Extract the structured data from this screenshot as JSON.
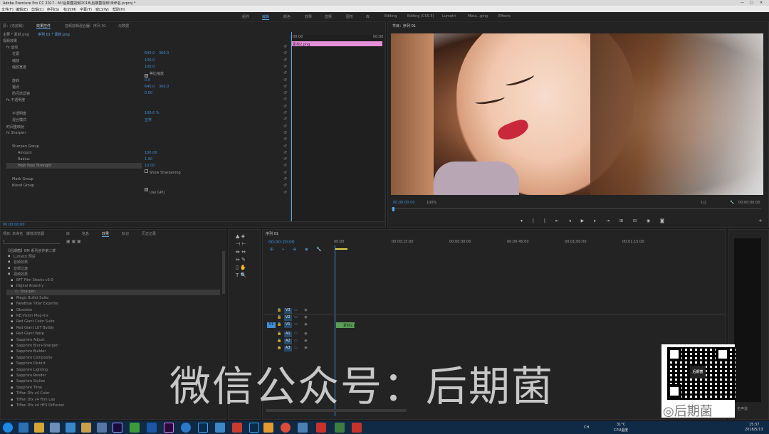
{
  "titlebar": {
    "title": "Adobe Premiere Pro CC 2017 - M:\\后期菌视频2018\\后期菌视频\\未命名.prproj *",
    "controls": [
      "—",
      "□",
      "✕"
    ]
  },
  "menubar": [
    "文件(F)",
    "编辑(E)",
    "剪辑(C)",
    "序列(S)",
    "标记(M)",
    "字幕(T)",
    "窗口(W)",
    "帮助(H)"
  ],
  "workspaces": {
    "items": [
      "组件",
      "编辑",
      "颜色",
      "效果",
      "音频",
      "图形",
      "库",
      "Editing",
      "Editing (CS5.5)",
      "Lumetri",
      "Meta...ging",
      "Effects"
    ],
    "active_index": 1
  },
  "effect_controls": {
    "tabs": [
      "源：(无剪辑)",
      "效果控件",
      "音频剪辑混合器：序列 01",
      "元数据"
    ],
    "active_tab": 1,
    "breadcrumb_source": "主要 * 素材.png",
    "breadcrumb_seq": "序列 01 * 素材.png",
    "section": "视频效果",
    "rows": [
      {
        "label": "fx 运动",
        "value": "",
        "value2": "",
        "indent": 0
      },
      {
        "label": "位置",
        "value": "640.0",
        "value2": "360.0",
        "indent": 1
      },
      {
        "label": "缩放",
        "value": "100.0",
        "value2": "",
        "indent": 1
      },
      {
        "label": "缩放宽度",
        "value": "100.0",
        "value2": "",
        "indent": 1
      },
      {
        "label": "",
        "value": "",
        "value2": "等比缩放",
        "indent": 1
      },
      {
        "label": "旋转",
        "value": "0.0",
        "value2": "",
        "indent": 1
      },
      {
        "label": "锚点",
        "value": "640.0",
        "value2": "360.0",
        "indent": 1
      },
      {
        "label": "防闪烁滤镜",
        "value": "0.00",
        "value2": "",
        "indent": 1
      },
      {
        "label": "fx 不透明度",
        "value": "",
        "value2": "",
        "indent": 0
      },
      {
        "label": "",
        "value": "",
        "value2": "",
        "indent": 1
      },
      {
        "label": "不透明度",
        "value": "100.0 %",
        "value2": "",
        "indent": 1
      },
      {
        "label": "混合模式",
        "value": "正常",
        "value2": "",
        "indent": 1
      },
      {
        "label": "时间重映射",
        "value": "",
        "value2": "",
        "indent": 0
      },
      {
        "label": "fx Sharpen",
        "value": "",
        "value2": "",
        "indent": 0
      },
      {
        "label": "",
        "value": "",
        "value2": "",
        "indent": 1
      },
      {
        "label": "Sharpen Group",
        "value": "",
        "value2": "",
        "indent": 1
      },
      {
        "label": "Amount",
        "value": "100.00",
        "value2": "",
        "indent": 2
      },
      {
        "label": "Radius",
        "value": "1.00",
        "value2": "",
        "indent": 2
      },
      {
        "label": "High Pass Strength",
        "value": "10.00",
        "value2": "",
        "indent": 2
      },
      {
        "label": "",
        "value": "",
        "value2": "Show Sharpening",
        "indent": 2
      },
      {
        "label": "Mask Group",
        "value": "",
        "value2": "",
        "indent": 1
      },
      {
        "label": "Blend Group",
        "value": "",
        "value2": "",
        "indent": 1
      },
      {
        "label": "",
        "value": "",
        "value2": "Use GPU",
        "indent": 1
      }
    ],
    "mini_timeline": {
      "start": "00:00",
      "end": "00:00",
      "clip_label": "素材2.png"
    },
    "timecode": "00:00:00:00"
  },
  "program_monitor": {
    "title": "节目：序列 01",
    "timecode_left": "00:00:00:00",
    "zoom": "100%",
    "quality": "1/2",
    "timecode_right": "00:00:00:00",
    "buttons": [
      "marker",
      "in-point",
      "out-point",
      "go-to-in",
      "step-back",
      "play",
      "step-forward",
      "go-to-out",
      "lift",
      "extract",
      "export-frame"
    ]
  },
  "project_panel": {
    "tabs": [
      "项目: 未命名",
      "媒体浏览器",
      "库",
      "信息",
      "效果",
      "标记",
      "历史记录"
    ],
    "active_tab": 4,
    "items": [
      "Lumetri 预设",
      "音频效果",
      "音频过渡",
      "视频效果",
      "BFT Film Stocks v3.0",
      "Digital Anarchy",
      "Sharpen",
      "Magic Bullet Suite",
      "NewBlue Titler Exporter",
      "Obsolete",
      "RE:Vision Plug-ins",
      "Red Giant Color Suite",
      "Red Giant LUT Buddy",
      "Red Giant Warp",
      "Sapphire Adjust",
      "Sapphire Blur+Sharpen",
      "Sapphire Builder",
      "Sapphire Composite",
      "Sapphire Distort",
      "Sapphire Lighting",
      "Sapphire Render",
      "Sapphire Stylize",
      "Sapphire Time",
      "Tiffen Dfx v4 Color",
      "Tiffen Dfx v4 Film Lab",
      "Tiffen Dfx v4 HFX Diffusion"
    ],
    "top_item": "【后期菌】BM 系列创作第二季"
  },
  "timeline": {
    "tab": "序列 01",
    "timecode": "00:00:20:00",
    "ruler": [
      "00:00",
      "00:00:15:00",
      "00:00:30:00",
      "00:00:45:00",
      "00:01:00:00",
      "00:01:15:00"
    ],
    "video_tracks": [
      "V3",
      "V2",
      "V1"
    ],
    "audio_tracks": [
      "A1",
      "A2",
      "A3"
    ],
    "source_patch_video": "V1",
    "clip_label": "素材2.png",
    "master": "主声道"
  },
  "watermark": {
    "text": "微信公众号：后期菌",
    "qr_label": "后期菌",
    "qr_caption": "后期菌"
  },
  "taskbar": {
    "tray_text": "CH",
    "temp": "31°C",
    "cpu": "CPU温度",
    "time": "15:37",
    "date": "2018/5/13"
  },
  "colors": {
    "accent": "#5aa7ea",
    "timecode_blue": "#3f8ed8",
    "clip_pink": "#e58fd9",
    "clip_green": "#5c9e58",
    "playhead_yellow": "#e5d24b"
  }
}
